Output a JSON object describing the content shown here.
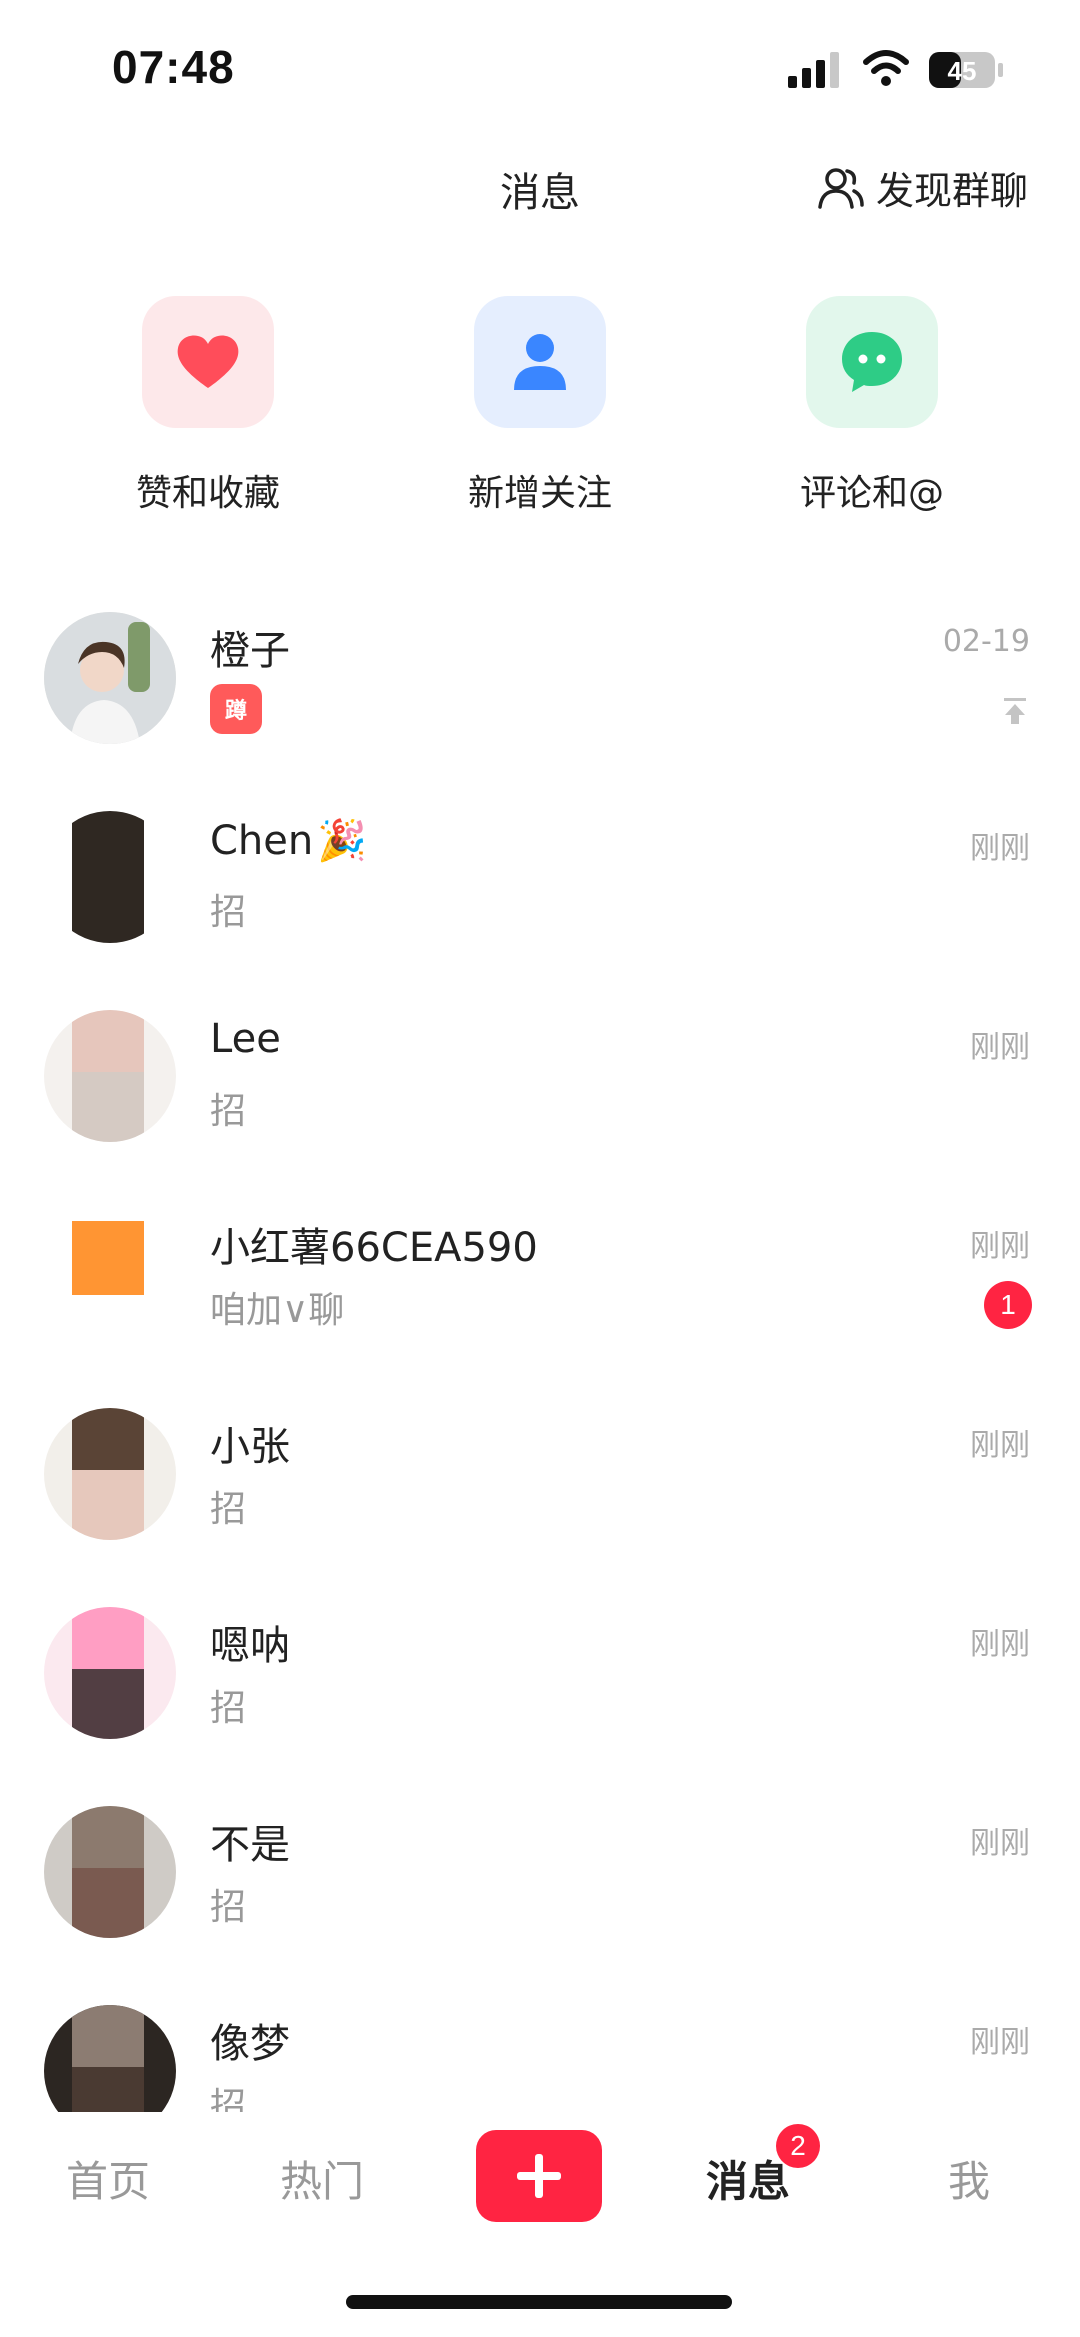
{
  "status_bar": {
    "time": "07:48",
    "battery": "45"
  },
  "header": {
    "title": "消息",
    "discover_label": "发现群聊"
  },
  "quick_actions": [
    {
      "label": "赞和收藏",
      "icon": "heart-icon",
      "color": "#ff4d5a"
    },
    {
      "label": "新增关注",
      "icon": "person-icon",
      "color": "#3a86ff"
    },
    {
      "label": "评论和@",
      "icon": "chat-bubble-icon",
      "color": "#2ecc86"
    }
  ],
  "conversations": [
    {
      "name": "橙子",
      "preview": "",
      "time": "02-19",
      "pinned": true,
      "sticker": "蹲"
    },
    {
      "name": "Chen",
      "preview": "招",
      "time": "刚刚",
      "emoji": "🎉"
    },
    {
      "name": "Lee",
      "preview": "招",
      "time": "刚刚"
    },
    {
      "name": "小红薯66CEA590",
      "preview": "咱加∨聊",
      "time": "刚刚",
      "unread": "1"
    },
    {
      "name": "小张",
      "preview": "招",
      "time": "刚刚"
    },
    {
      "name": "嗯呐",
      "preview": "招",
      "time": "刚刚"
    },
    {
      "name": "不是",
      "preview": "招",
      "time": "刚刚"
    },
    {
      "name": "像梦",
      "preview": "招",
      "time": "刚刚"
    }
  ],
  "tabbar": {
    "home": "首页",
    "hot": "热门",
    "messages": "消息",
    "me": "我",
    "messages_badge": "2"
  },
  "colors": {
    "brand": "#ff2442"
  }
}
